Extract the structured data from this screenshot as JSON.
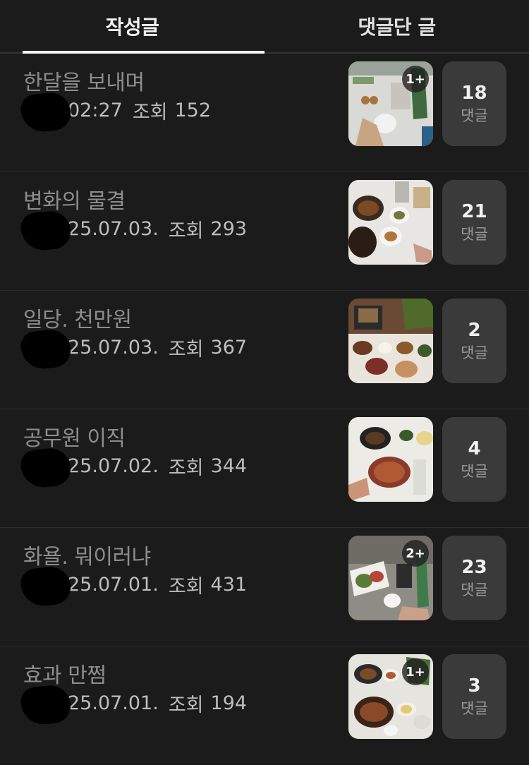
{
  "tabs": {
    "written": "작성글",
    "commented": "댓글단 글"
  },
  "posts": [
    {
      "title": "한달을 보내며",
      "date": "02:27",
      "views_label": "조회",
      "views": "152",
      "thumb_badge": "1+",
      "comments": "18",
      "comments_label": "댓글"
    },
    {
      "title": "변화의 물결",
      "date": "25.07.03.",
      "views_label": "조회",
      "views": "293",
      "thumb_badge": "",
      "comments": "21",
      "comments_label": "댓글"
    },
    {
      "title": "일당. 천만원",
      "date": "25.07.03.",
      "views_label": "조회",
      "views": "367",
      "thumb_badge": "",
      "comments": "2",
      "comments_label": "댓글"
    },
    {
      "title": "공무원 이직",
      "date": "25.07.02.",
      "views_label": "조회",
      "views": "344",
      "thumb_badge": "",
      "comments": "4",
      "comments_label": "댓글"
    },
    {
      "title": "화욜. 뭐이러냐",
      "date": "25.07.01.",
      "views_label": "조회",
      "views": "431",
      "thumb_badge": "2+",
      "comments": "23",
      "comments_label": "댓글"
    },
    {
      "title": "효과 만쩜",
      "date": "25.07.01.",
      "views_label": "조회",
      "views": "194",
      "thumb_badge": "1+",
      "comments": "3",
      "comments_label": "댓글"
    }
  ],
  "colors": {
    "background": "#1b1b1b",
    "title": "#8d8d8d",
    "meta": "#bdbdbd",
    "comment_box": "#3a3a3a"
  }
}
